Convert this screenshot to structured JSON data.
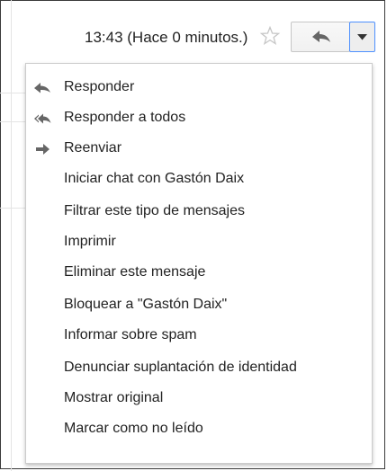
{
  "header": {
    "time_label": "13:43 (Hace 0 minutos.)",
    "star_icon": "star-outline-icon",
    "reply_icon": "reply-arrow-icon",
    "more_icon": "caret-down-icon"
  },
  "menu": {
    "items": [
      {
        "label": "Responder",
        "icon": "reply-icon"
      },
      {
        "label": "Responder a todos",
        "icon": "reply-all-icon"
      },
      {
        "label": "Reenviar",
        "icon": "forward-icon"
      },
      {
        "label": "Iniciar chat con Gastón Daix"
      },
      {
        "label": "Filtrar este tipo de mensajes"
      },
      {
        "label": "Imprimir"
      },
      {
        "label": "Eliminar este mensaje"
      },
      {
        "label": "Bloquear a \"Gastón Daix\""
      },
      {
        "label": "Informar sobre spam"
      },
      {
        "label": "Denunciar suplantación de identidad"
      },
      {
        "label": "Mostrar original"
      },
      {
        "label": "Marcar como no leído"
      }
    ]
  },
  "colors": {
    "text": "#222222",
    "icon": "#666666",
    "focus_border": "#4d90fe",
    "star": "#c6c6c6"
  }
}
